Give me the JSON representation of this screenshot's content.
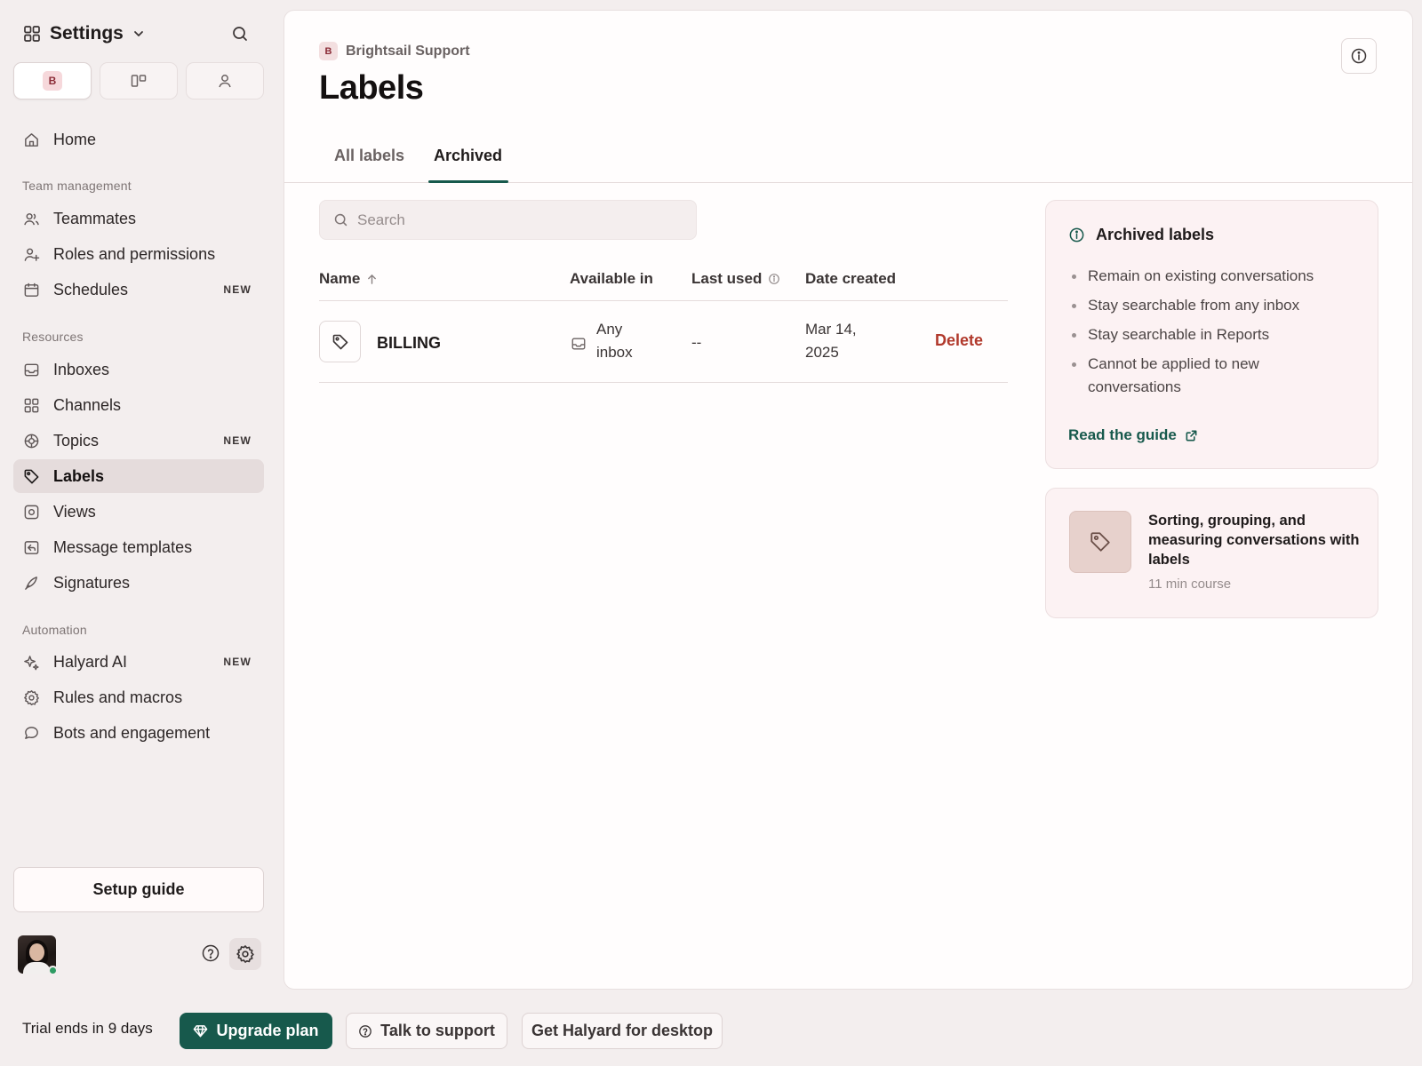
{
  "sidebar": {
    "title": "Settings",
    "workspace_badge": "B",
    "home": "Home",
    "sections": {
      "team": "Team management",
      "resources": "Resources",
      "automation": "Automation"
    },
    "items": [
      {
        "label": "Teammates",
        "icon": "users-icon"
      },
      {
        "label": "Roles and permissions",
        "icon": "user-plus-icon"
      },
      {
        "label": "Schedules",
        "icon": "calendar-icon",
        "badge": "NEW"
      },
      {
        "label": "Inboxes",
        "icon": "inbox-icon"
      },
      {
        "label": "Channels",
        "icon": "grid-icon"
      },
      {
        "label": "Topics",
        "icon": "topics-icon",
        "badge": "NEW"
      },
      {
        "label": "Labels",
        "icon": "tag-icon",
        "active": true
      },
      {
        "label": "Views",
        "icon": "views-icon"
      },
      {
        "label": "Message templates",
        "icon": "template-icon"
      },
      {
        "label": "Signatures",
        "icon": "feather-icon"
      },
      {
        "label": "Halyard AI",
        "icon": "sparkle-icon",
        "badge": "NEW"
      },
      {
        "label": "Rules and macros",
        "icon": "gear-icon"
      },
      {
        "label": "Bots and engagement",
        "icon": "chat-bubble-icon"
      }
    ],
    "setup_guide": "Setup guide"
  },
  "bottom_bar": {
    "trial": "Trial ends in 9 days",
    "upgrade": "Upgrade plan",
    "support": "Talk to support",
    "desktop": "Get Halyard for desktop"
  },
  "main": {
    "breadcrumb_badge": "B",
    "breadcrumb": "Brightsail Support",
    "title": "Labels",
    "tabs": [
      {
        "label": "All labels",
        "active": false
      },
      {
        "label": "Archived",
        "active": true
      }
    ],
    "search_placeholder": "Search",
    "columns": {
      "name": "Name",
      "available_in": "Available in",
      "last_used": "Last used",
      "date_created": "Date created"
    },
    "rows": [
      {
        "name": "BILLING",
        "available_line1": "Any",
        "available_line2": "inbox",
        "last_used": "--",
        "date_line1": "Mar 14,",
        "date_line2": "2025",
        "action": "Delete"
      }
    ]
  },
  "info_card": {
    "title": "Archived labels",
    "bullets": [
      "Remain on existing conversations",
      "Stay searchable from any inbox",
      "Stay searchable in Reports",
      "Cannot be applied to new conversations"
    ],
    "link": "Read the guide"
  },
  "course_card": {
    "title": "Sorting, grouping, and measuring conversations with labels",
    "meta": "11 min course"
  },
  "colors": {
    "accent": "#17594c",
    "danger": "#b1392c",
    "badge_bg": "#f6d8db",
    "active_nav": "#e5dcdc"
  }
}
